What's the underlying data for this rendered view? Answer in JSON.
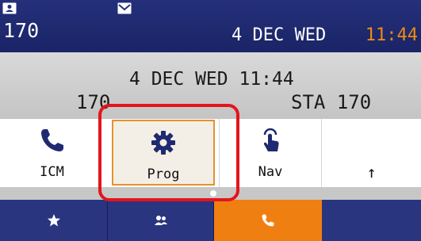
{
  "status_bar": {
    "icons": [
      "phonebook-icon",
      "mail-icon"
    ],
    "extension": "170",
    "date": "4 DEC WED",
    "time": "11:44",
    "time_color": "#f08a10"
  },
  "idle": {
    "datetime": "4 DEC WED 11:44",
    "extension": "170",
    "station": "STA 170"
  },
  "softkeys": [
    {
      "label": "ICM",
      "icon": "phone-icon"
    },
    {
      "label": "Prog",
      "icon": "gear-icon",
      "selected": true
    },
    {
      "label": "Nav",
      "icon": "touch-icon"
    },
    {
      "label": "↑",
      "icon": ""
    }
  ],
  "tabs": [
    {
      "icon": "star-icon",
      "active": false
    },
    {
      "icon": "contacts-icon",
      "active": false
    },
    {
      "icon": "phone-icon",
      "active": true
    },
    {
      "icon": "",
      "active": false
    }
  ],
  "colors": {
    "statusbar_bg": "#1f2a6e",
    "active_tab": "#f07f12",
    "selected_border": "#e8902a",
    "highlight": "#e3151b"
  }
}
